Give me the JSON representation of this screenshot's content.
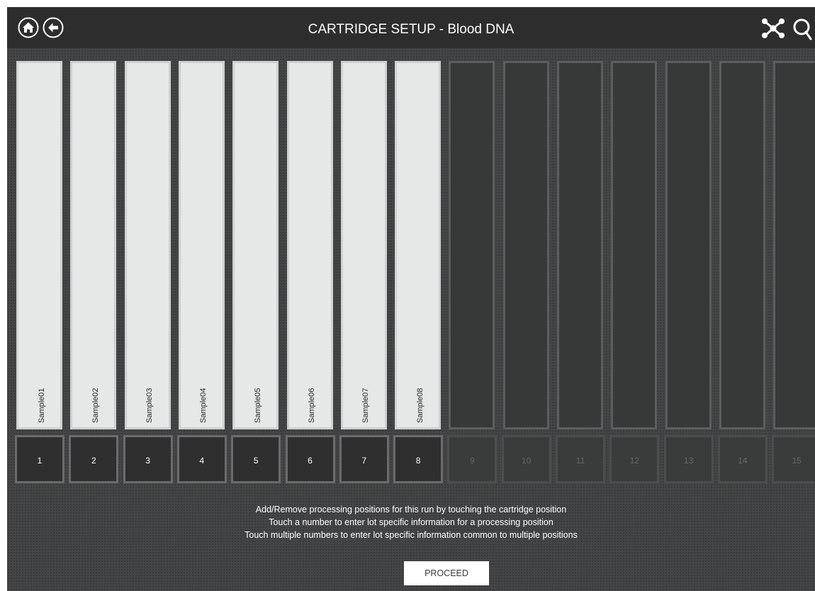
{
  "header": {
    "title": "CARTRIDGE SETUP - Blood DNA",
    "left_icons": [
      "home-icon",
      "back-arrow-icon"
    ],
    "right_icons": [
      "network-icon",
      "search-icon"
    ]
  },
  "cartridges": [
    {
      "number": "1",
      "sample": "Sample01",
      "active": true
    },
    {
      "number": "2",
      "sample": "Sample02",
      "active": true
    },
    {
      "number": "3",
      "sample": "Sample03",
      "active": true
    },
    {
      "number": "4",
      "sample": "Sample04",
      "active": true
    },
    {
      "number": "5",
      "sample": "Sample05",
      "active": true
    },
    {
      "number": "6",
      "sample": "Sample06",
      "active": true
    },
    {
      "number": "7",
      "sample": "Sample07",
      "active": true
    },
    {
      "number": "8",
      "sample": "Sample08",
      "active": true
    },
    {
      "number": "9",
      "sample": "",
      "active": false
    },
    {
      "number": "10",
      "sample": "",
      "active": false
    },
    {
      "number": "11",
      "sample": "",
      "active": false
    },
    {
      "number": "12",
      "sample": "",
      "active": false
    },
    {
      "number": "13",
      "sample": "",
      "active": false
    },
    {
      "number": "14",
      "sample": "",
      "active": false
    },
    {
      "number": "15",
      "sample": "",
      "active": false
    }
  ],
  "instructions": [
    "Add/Remove processing positions for this run by touching the cartridge position",
    "Touch a number to enter lot specific information for a processing position",
    "Touch multiple numbers to enter lot specific information common to multiple positions"
  ],
  "proceed_label": "PROCEED",
  "colors": {
    "background": "#444546",
    "header": "#2d2d2e",
    "active_slot": "#e6e7e7",
    "inactive_slot": "#373838"
  }
}
